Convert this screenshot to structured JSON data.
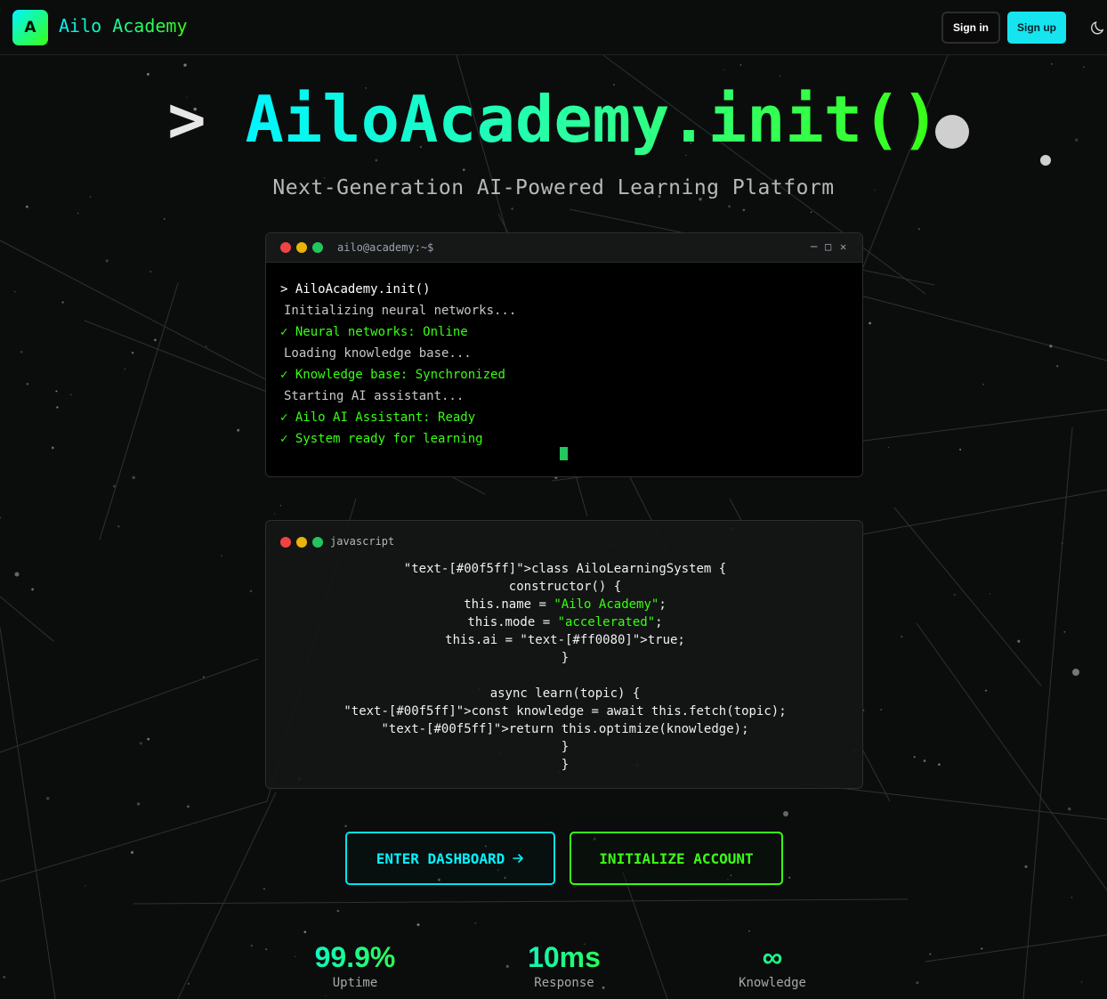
{
  "header": {
    "logo_letter": "A",
    "brand": "Ailo Academy",
    "signin_label": "Sign in",
    "signup_label": "Sign up",
    "theme_icon": "moon-icon"
  },
  "hero": {
    "prompt": ">",
    "title": "AiloAcademy.init()",
    "subtitle": "Next-Generation AI-Powered Learning Platform"
  },
  "terminal": {
    "title": "ailo@academy:~$",
    "controls": [
      "─",
      "□",
      "✕"
    ],
    "command_prompt": ">",
    "command": "AiloAcademy.init()",
    "lines": [
      {
        "mark": "",
        "text": "Initializing neural networks..."
      },
      {
        "mark": "✓",
        "text": "Neural networks: Online"
      },
      {
        "mark": "",
        "text": "Loading knowledge base..."
      },
      {
        "mark": "✓",
        "text": "Knowledge base: Synchronized"
      },
      {
        "mark": "",
        "text": "Starting AI assistant..."
      },
      {
        "mark": "✓",
        "text": "Ailo AI Assistant: Ready"
      },
      {
        "mark": "✓",
        "text": "System ready for learning"
      }
    ]
  },
  "code": {
    "language": "javascript",
    "lines": [
      {
        "pre": "\"text-[#00f5ff]\">class AiloLearningSystem {",
        "str": "",
        "post": ""
      },
      {
        "pre": "constructor() {",
        "str": "",
        "post": ""
      },
      {
        "pre": "this.name = ",
        "str": "\"Ailo Academy\"",
        "post": ";"
      },
      {
        "pre": "this.mode = ",
        "str": "\"accelerated\"",
        "post": ";"
      },
      {
        "pre": "this.ai = \"text-[#ff0080]\">true;",
        "str": "",
        "post": ""
      },
      {
        "pre": "}",
        "str": "",
        "post": ""
      },
      {
        "pre": "",
        "str": "",
        "post": ""
      },
      {
        "pre": "async learn(topic) {",
        "str": "",
        "post": ""
      },
      {
        "pre": "\"text-[#00f5ff]\">const knowledge = await this.fetch(topic);",
        "str": "",
        "post": ""
      },
      {
        "pre": "\"text-[#00f5ff]\">return this.optimize(knowledge);",
        "str": "",
        "post": ""
      },
      {
        "pre": "}",
        "str": "",
        "post": ""
      },
      {
        "pre": "}",
        "str": "",
        "post": ""
      }
    ]
  },
  "cta": {
    "dashboard_label": "ENTER DASHBOARD",
    "initialize_label": "INITIALIZE ACCOUNT"
  },
  "stats": [
    {
      "value": "99.9%",
      "label": "Uptime"
    },
    {
      "value": "10ms",
      "label": "Response"
    },
    {
      "value": "∞",
      "label": "Knowledge"
    }
  ],
  "colors": {
    "cyan": "#00f5ff",
    "green": "#39ff14",
    "background": "#0b0d0c"
  }
}
